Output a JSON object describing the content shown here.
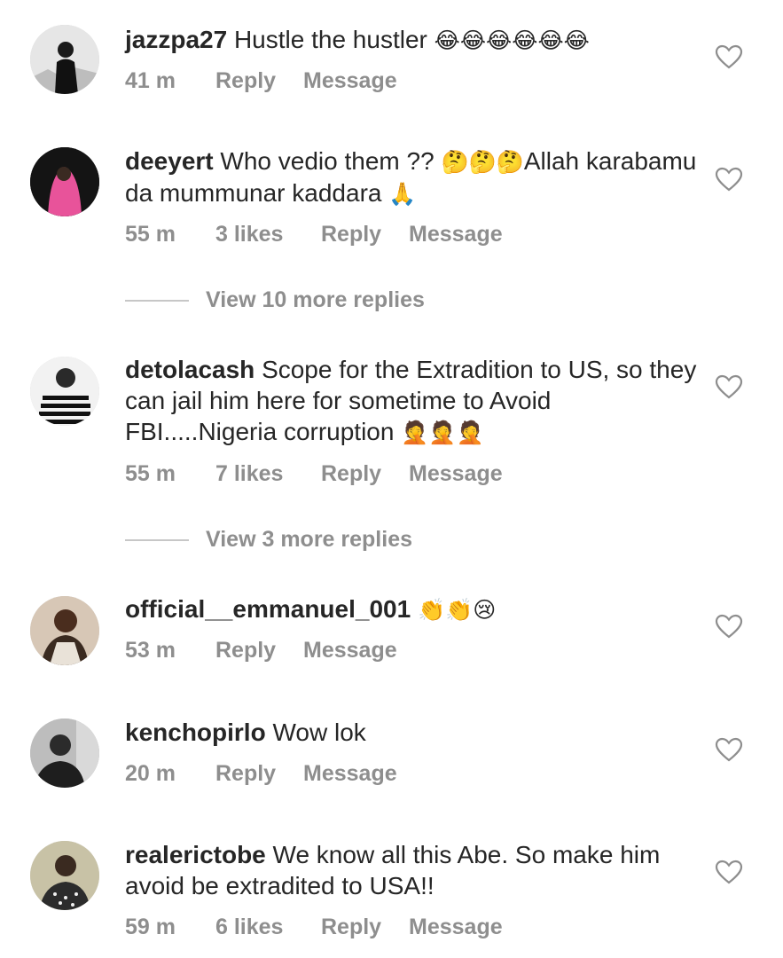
{
  "comments": [
    {
      "username": "jazzpa27",
      "text": "Hustle the hustler",
      "emoji": "😂😂😂😂😂😂",
      "time": "41 m",
      "likes": "",
      "reply": "Reply",
      "message": "Message"
    },
    {
      "username": "deeyert",
      "text": "Who vedio them ??",
      "emoji": "🤔🤔🤔",
      "text2": "Allah karabamu da mummunar kaddara",
      "emoji2": "🙏",
      "time": "55 m",
      "likes": "3 likes",
      "reply": "Reply",
      "message": "Message"
    },
    {
      "username": "detolacash",
      "text": "Scope for the Extradition to US, so they can jail him here for sometime to Avoid FBI.....Nigeria corruption",
      "emoji": "🤦🤦🤦",
      "time": "55 m",
      "likes": "7 likes",
      "reply": "Reply",
      "message": "Message"
    },
    {
      "username": "official__emmanuel_001",
      "text": "",
      "emoji": "👏👏😢",
      "time": "53 m",
      "likes": "",
      "reply": "Reply",
      "message": "Message"
    },
    {
      "username": "kenchopirlo",
      "text": "Wow lok",
      "emoji": "",
      "time": "20 m",
      "likes": "",
      "reply": "Reply",
      "message": "Message"
    },
    {
      "username": "realerictobe",
      "text": "We know all this Abe. So make him avoid be extradited to USA!!",
      "emoji": "",
      "time": "59 m",
      "likes": "6 likes",
      "reply": "Reply",
      "message": "Message"
    }
  ],
  "view_replies": [
    {
      "label": "View 10 more replies"
    },
    {
      "label": "View 3 more replies"
    }
  ],
  "icons": {
    "heart": "heart-outline-icon"
  },
  "colors": {
    "text": "#262626",
    "meta": "#8e8e8e",
    "divider": "#c7c7c7"
  }
}
